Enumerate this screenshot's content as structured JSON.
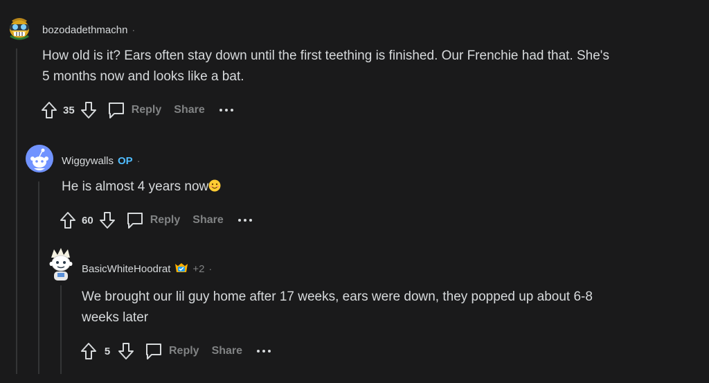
{
  "comments": [
    {
      "author": "bozodadethmachn",
      "op_badge": "",
      "karma": "",
      "separator": "·",
      "body_lines": [
        "How old is it? Ears often stay down until the first teething is finished. Our Frenchie had that. She's",
        "5 months now and looks like a bat."
      ],
      "score": "35",
      "reply_label": "Reply",
      "share_label": "Share",
      "avatar_icon": "snoo-goggles-avatar"
    },
    {
      "author": "Wiggywalls",
      "op_badge": "OP",
      "karma": "",
      "separator": "·",
      "body_lines": [
        "He is almost 4 years now"
      ],
      "body_emoji": "smiling-face-emoji",
      "score": "60",
      "reply_label": "Reply",
      "share_label": "Share",
      "avatar_icon": "default-snoo-avatar"
    },
    {
      "author": "BasicWhiteHoodrat",
      "op_badge": "",
      "karma": "+2",
      "separator": "·",
      "body_lines": [
        "We brought our lil guy home after 17 weeks, ears were down, they popped up about 6-8",
        "weeks later"
      ],
      "score": "5",
      "reply_label": "Reply",
      "share_label": "Share",
      "avatar_icon": "snoo-white-hair-avatar",
      "flair_icon": "achievement-badge-icon"
    }
  ],
  "colors": {
    "background": "#1a1a1b",
    "text": "#d7dadc",
    "muted": "#818384",
    "op": "#4fbcff",
    "thread_line": "#343536"
  }
}
